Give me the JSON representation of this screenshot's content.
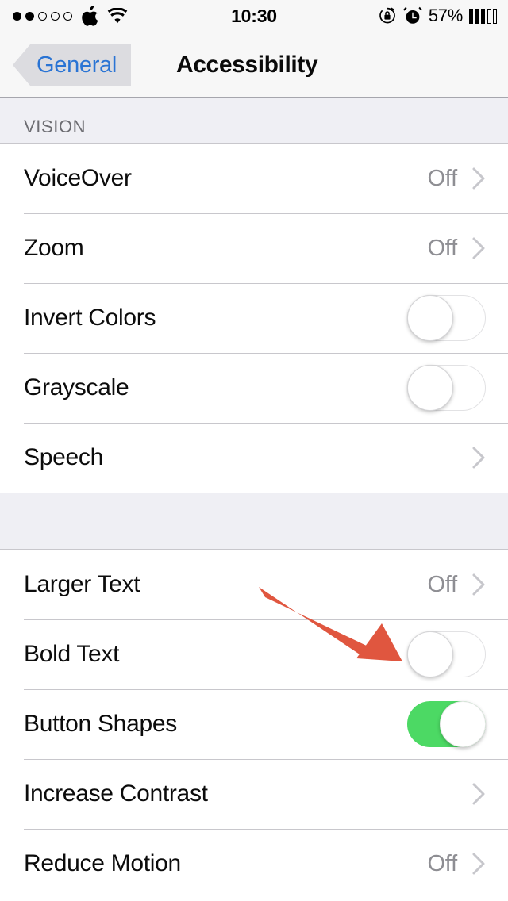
{
  "status_bar": {
    "signal_dots": [
      true,
      true,
      false,
      false,
      false
    ],
    "apple_logo_icon": "apple-logo-icon",
    "wifi_icon": "wifi-icon",
    "time": "10:30",
    "rotation_lock_icon": "rotation-lock-icon",
    "alarm_icon": "alarm-clock-icon",
    "battery_percent": "57%",
    "battery_bars": [
      true,
      true,
      true,
      false,
      false
    ]
  },
  "nav_bar": {
    "back_label": "General",
    "title": "Accessibility",
    "back_tint_color": "#2a74d4",
    "button_shape_bg": "#dcdce0"
  },
  "sections": [
    {
      "header": "VISION",
      "rows": [
        {
          "label": "VoiceOver",
          "value": "Off",
          "control": "chevron"
        },
        {
          "label": "Zoom",
          "value": "Off",
          "control": "chevron"
        },
        {
          "label": "Invert Colors",
          "value": "",
          "control": "toggle",
          "toggle_on": false
        },
        {
          "label": "Grayscale",
          "value": "",
          "control": "toggle",
          "toggle_on": false
        },
        {
          "label": "Speech",
          "value": "",
          "control": "chevron"
        }
      ]
    },
    {
      "header": "",
      "rows": [
        {
          "label": "Larger Text",
          "value": "Off",
          "control": "chevron"
        },
        {
          "label": "Bold Text",
          "value": "",
          "control": "toggle",
          "toggle_on": false
        },
        {
          "label": "Button Shapes",
          "value": "",
          "control": "toggle",
          "toggle_on": true
        },
        {
          "label": "Increase Contrast",
          "value": "",
          "control": "chevron"
        },
        {
          "label": "Reduce Motion",
          "value": "Off",
          "control": "chevron"
        }
      ]
    }
  ],
  "annotation": {
    "arrow_color": "#e0563f",
    "points_to": "bold-text-toggle"
  },
  "colors": {
    "toggle_on": "#4cd964",
    "value_gray": "#8e8e93",
    "chevron_gray": "#c7c7cc",
    "group_bg": "#efeff4",
    "separator": "#c8c7cc",
    "bar_bg": "#f7f7f7"
  }
}
